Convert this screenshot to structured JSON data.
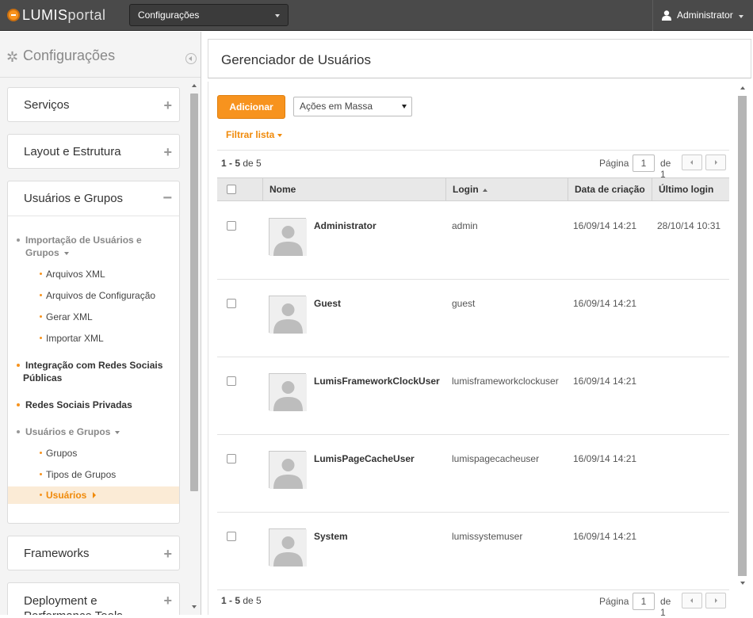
{
  "topbar": {
    "logo_bold": "LUMIS",
    "logo_light": "portal",
    "section_select": "Configurações",
    "user_menu": "Administrator"
  },
  "sidebar": {
    "title": "Configurações",
    "panels": {
      "servicos": "Serviços",
      "layout": "Layout e Estrutura",
      "usuarios_grupos": "Usuários e Grupos",
      "frameworks": "Frameworks",
      "deployment": "Deployment e Performance Tools"
    },
    "tree": {
      "importacao": "Importação de Usuários e",
      "importacao_2": "Grupos",
      "arquivos_xml": "Arquivos XML",
      "arquivos_config": "Arquivos de Configuração",
      "gerar_xml": "Gerar XML",
      "importar_xml": "Importar XML",
      "integracao": "Integração com Redes Sociais",
      "integracao_2": "Públicas",
      "redes_privadas": "Redes Sociais Privadas",
      "usuarios_grupos": "Usuários e Grupos",
      "grupos": "Grupos",
      "tipos_grupos": "Tipos de Grupos",
      "usuarios": "Usuários"
    }
  },
  "main": {
    "title": "Gerenciador de Usuários",
    "add_button": "Adicionar",
    "mass_actions": "Ações em Massa",
    "filter": "Filtrar lista",
    "count_range": "1 - 5",
    "count_of": "de 5",
    "pager": {
      "page_label": "Página",
      "page_value": "1",
      "of_label": "de 1"
    },
    "columns": {
      "name": "Nome",
      "login": "Login",
      "created": "Data de criação",
      "last_login": "Último login"
    },
    "rows": [
      {
        "name": "Administrator",
        "login": "admin",
        "created": "16/09/14 14:21",
        "last_login": "28/10/14 10:31"
      },
      {
        "name": "Guest",
        "login": "guest",
        "created": "16/09/14 14:21",
        "last_login": ""
      },
      {
        "name": "LumisFrameworkClockUser",
        "login": "lumisframeworkclockuser",
        "created": "16/09/14 14:21",
        "last_login": ""
      },
      {
        "name": "LumisPageCacheUser",
        "login": "lumispagecacheuser",
        "created": "16/09/14 14:21",
        "last_login": ""
      },
      {
        "name": "System",
        "login": "lumissystemuser",
        "created": "16/09/14 14:21",
        "last_login": ""
      }
    ]
  },
  "colors": {
    "accent": "#f7931e",
    "topbar": "#4a4a4a",
    "active_bg": "#fbebd6"
  }
}
